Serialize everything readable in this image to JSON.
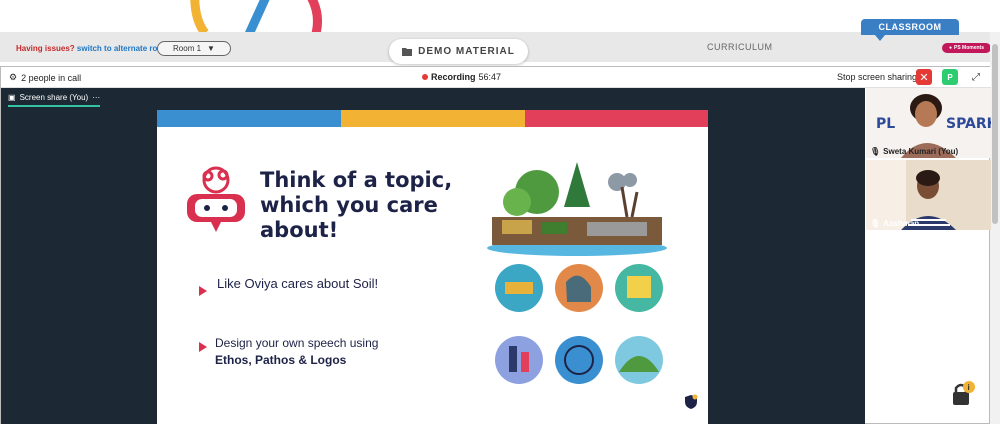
{
  "top": {
    "issues_prefix": "Having issues?",
    "issues_link": "switch to alternate room",
    "room_select": "Room 1",
    "demo_button": "DEMO MATERIAL",
    "curriculum": "CURRICULUM",
    "classroom_tab": "CLASSROOM",
    "moments_badge": "PS Moments"
  },
  "call": {
    "people_count": "2 people in call",
    "recording_label": "Recording",
    "recording_time": "56:47",
    "stop_sharing": "Stop screen sharing",
    "p_button": "P",
    "share_tab": "Screen share (You)",
    "share_more": "···"
  },
  "slide": {
    "title": "Think of a topic, which you care about!",
    "bullet1": "Like Oviya cares about Soil!",
    "bullet2_line": "Design your own speech using",
    "bullet2_bold": "Ethos, Pathos & Logos",
    "stripe_colors": [
      "#3a8fd0",
      "#f2b233",
      "#e23f5a"
    ]
  },
  "participants": [
    {
      "name": "Sweta Kumari (You)",
      "logo_text_left": "PL",
      "logo_text_right": "SPARK"
    },
    {
      "name": "Aashman"
    }
  ]
}
